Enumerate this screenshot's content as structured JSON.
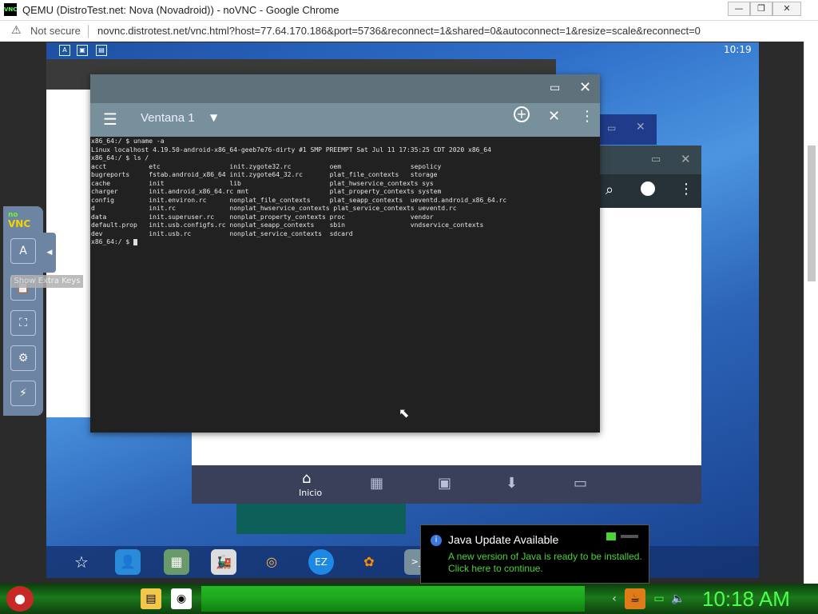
{
  "browser": {
    "window_title": "QEMU (DistroTest.net: Nova (Novadroid)) - noVNC - Google Chrome",
    "app_icon_text": "VNC",
    "security_label": "Not secure",
    "url": "novnc.distrotest.net/vnc.html?host=77.64.170.186&port=5736&reconnect=1&shared=0&autoconnect=1&resize=scale&reconnect=0",
    "window_buttons": [
      "—",
      "❐",
      "✕"
    ]
  },
  "android": {
    "status_time": "10:19",
    "status_icons": [
      "A",
      "▣",
      "▤"
    ],
    "terminal": {
      "tab_name": "Ventana 1",
      "lines": [
        "x86_64:/ $ uname -a",
        "Linux localhost 4.19.50-android-x86_64-geeb7e76-dirty #1 SMP PREEMPT Sat Jul 11 17:35:25 CDT 2020 x86_64",
        "x86_64:/ $ ls /",
        "acct           etc                  init.zygote32.rc          oem                  sepolicy",
        "bugreports     fstab.android_x86_64 init.zygote64_32.rc       plat_file_contexts   storage",
        "cache          init                 lib                       plat_hwservice_contexts sys",
        "charger        init.android_x86_64.rc mnt                     plat_property_contexts system",
        "config         init.environ.rc      nonplat_file_contexts     plat_seapp_contexts  ueventd.android_x86_64.rc",
        "d              init.rc              nonplat_hwservice_contexts plat_service_contexts ueventd.rc",
        "data           init.superuser.rc    nonplat_property_contexts proc                 vendor",
        "default.prop   init.usb.configfs.rc nonplat_seapp_contexts    sbin                 vndservice_contexts",
        "dev            init.usb.rc          nonplat_service_contexts  sdcard"
      ],
      "prompt": "x86_64:/ $ "
    },
    "second_window": {
      "nav_home_label": "Inicio"
    }
  },
  "novnc": {
    "logo_top": "no",
    "logo_bottom": "VNC",
    "tooltip": "Show Extra Keys",
    "buttons": [
      "A",
      "📋",
      "⛶",
      "⚙",
      "⚡"
    ]
  },
  "java_popup": {
    "title": "Java Update Available",
    "line1": "A new version of Java is ready to be installed.",
    "line2": "Click here to continue."
  },
  "taskbar": {
    "clock": "10:18 AM"
  },
  "colors": {
    "terminal_bg": "#212121",
    "terminal_header": "#78909c",
    "taskbar_green": "#1c7a1c",
    "clock_green": "#4cff4c",
    "java_text_green": "#4cd137"
  }
}
